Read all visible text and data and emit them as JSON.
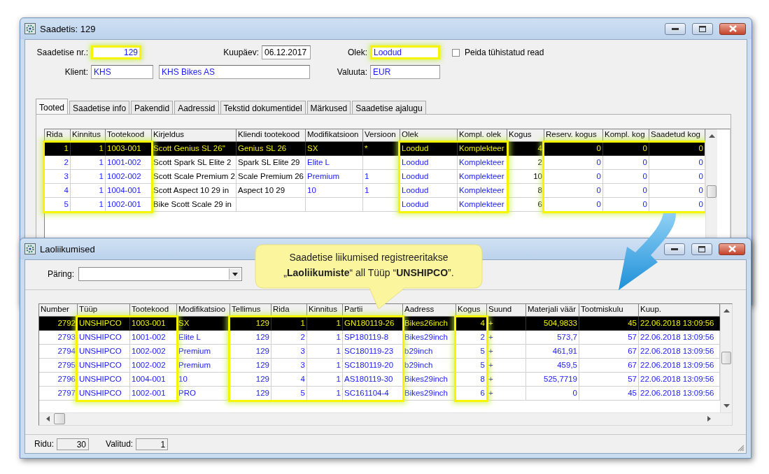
{
  "main_window": {
    "title": "Saadetis: 129",
    "shipment_no": {
      "label": "Saadetise nr.:",
      "value": "129",
      "kind": "ref",
      "highlighted": true
    },
    "date": {
      "label": "Kuupäev:",
      "value": "06.12.2017",
      "kind": "text",
      "highlighted": false
    },
    "status": {
      "label": "Olek:",
      "value": "Loodud",
      "kind": "ref",
      "highlighted": true
    },
    "hide_cancelled": {
      "label": "Peida tühistatud read",
      "checked": false
    },
    "client": {
      "label": "Klient:",
      "code": {
        "value": "KHS",
        "kind": "ref",
        "highlighted": false
      },
      "name": {
        "value": "KHS Bikes AS",
        "kind": "ref",
        "highlighted": false
      }
    },
    "currency": {
      "label": "Valuuta:",
      "value": "EUR",
      "kind": "ref",
      "highlighted": false
    },
    "tabs": [
      {
        "label": "Tooted",
        "selected": true
      },
      {
        "label": "Saadetise info",
        "selected": false
      },
      {
        "label": "Pakendid",
        "selected": false
      },
      {
        "label": "Aadressid",
        "selected": false
      },
      {
        "label": "Tekstid dokumentidel",
        "selected": false
      },
      {
        "label": "Märkused",
        "selected": false
      },
      {
        "label": "Saadetise ajalugu",
        "selected": false
      }
    ],
    "table": {
      "columns": [
        {
          "title": "Rida",
          "kind": "ref-number",
          "highlighted": true
        },
        {
          "title": "Kinnitus",
          "kind": "ref-number",
          "highlighted": true
        },
        {
          "title": "Tootekood",
          "kind": "ref-text",
          "highlighted": true
        },
        {
          "title": "Kirjeldus",
          "kind": "text",
          "highlighted": false
        },
        {
          "title": "Kliendi tootekood",
          "kind": "text",
          "highlighted": false
        },
        {
          "title": "Modifikatsioon",
          "kind": "ref-text",
          "highlighted": false
        },
        {
          "title": "Versioon",
          "kind": "ref-text",
          "highlighted": false
        },
        {
          "title": "Olek",
          "kind": "ref-text",
          "highlighted": true
        },
        {
          "title": "Kompl. olek",
          "kind": "ref-text",
          "highlighted": true
        },
        {
          "title": "Kogus",
          "kind": "number",
          "highlighted": false
        },
        {
          "title": "Reserv. kogus",
          "kind": "ref-number",
          "highlighted": true
        },
        {
          "title": "Kompl. kog",
          "kind": "ref-number",
          "highlighted": true
        },
        {
          "title": "Saadetud kog",
          "kind": "ref-number",
          "highlighted": true
        }
      ],
      "rows": [
        {
          "selected": true,
          "cells": [
            "1",
            "1",
            "1003-001",
            "Scott Genius SL 26''",
            "Genius SL 26",
            "SX",
            "*",
            "Loodud",
            "Komplekteer",
            "4",
            "0",
            "0",
            "0"
          ]
        },
        {
          "selected": false,
          "cells": [
            "2",
            "1",
            "1001-002",
            "Scott Spark SL Elite 2",
            "Spark SL Elite 29",
            "Elite L",
            null,
            "Loodud",
            "Komplekteer",
            "2",
            "0",
            "0",
            "0"
          ]
        },
        {
          "selected": false,
          "cells": [
            "3",
            "1",
            "1002-002",
            "Scott Scale Premium 2",
            "Scale Premium 26",
            "Premium",
            "1",
            "Loodud",
            "Komplekteer",
            "10",
            "0",
            "0",
            "0"
          ]
        },
        {
          "selected": false,
          "cells": [
            "4",
            "1",
            "1004-001",
            "Scott Aspect 10 29 in",
            "Aspect 10 29",
            "10",
            "1",
            "Loodud",
            "Komplekteer",
            "8",
            "0",
            "0",
            "0"
          ]
        },
        {
          "selected": false,
          "cells": [
            "5",
            "1",
            "1002-001",
            "Bike Scott Scale 29 in",
            null,
            null,
            null,
            "Loodud",
            "Komplekteer",
            "6",
            "0",
            "0",
            "0"
          ]
        }
      ]
    }
  },
  "movements_window": {
    "title": "Laoliikumised",
    "query": {
      "label": "Päring:"
    },
    "table": {
      "columns": [
        {
          "title": "Number",
          "kind": "ref-number",
          "highlighted": false
        },
        {
          "title": "Tüüp",
          "kind": "ref-text",
          "highlighted": true
        },
        {
          "title": "Tootekood",
          "kind": "ref-text",
          "highlighted": true
        },
        {
          "title": "Modifikatsioo",
          "kind": "ref-text",
          "highlighted": false
        },
        {
          "title": "Tellimus",
          "kind": "ref-number",
          "highlighted": true
        },
        {
          "title": "Rida",
          "kind": "ref-number",
          "highlighted": true
        },
        {
          "title": "Kinnitus",
          "kind": "ref-number",
          "highlighted": true
        },
        {
          "title": "Partii",
          "kind": "ref-text",
          "highlighted": true
        },
        {
          "title": "Aadress",
          "kind": "ref-text",
          "highlighted": false
        },
        {
          "title": "Kogus",
          "kind": "ref-number",
          "highlighted": true
        },
        {
          "title": "Suund",
          "kind": "ref-text",
          "highlighted": false
        },
        {
          "title": "Materjali väär",
          "kind": "ref-number",
          "highlighted": false
        },
        {
          "title": "Tootmiskulu",
          "kind": "ref-number",
          "highlighted": false
        },
        {
          "title": "Kuup.",
          "kind": "ref-text",
          "highlighted": false
        }
      ],
      "rows": [
        {
          "selected": true,
          "cells": [
            "2792",
            "UNSHIPCO",
            "1003-001",
            "SX",
            "129",
            "1",
            "1",
            "GN180119-26",
            "Bikes26inch",
            "4",
            "+",
            "504,9833",
            "45",
            "22.06.2018 13:09:56"
          ]
        },
        {
          "selected": false,
          "cells": [
            "2793",
            "UNSHIPCO",
            "1001-002",
            "Elite L",
            "129",
            "2",
            "1",
            "SP180119-8",
            "Bikes29inch",
            "2",
            "+",
            "573,7",
            "57",
            "22.06.2018 13:09:56"
          ]
        },
        {
          "selected": false,
          "cells": [
            "2794",
            "UNSHIPCO",
            "1002-002",
            "Premium",
            "129",
            "3",
            "1",
            "SC180119-23",
            "b29inch",
            "5",
            "+",
            "461,91",
            "67",
            "22.06.2018 13:09:56"
          ]
        },
        {
          "selected": false,
          "cells": [
            "2795",
            "UNSHIPCO",
            "1002-002",
            "Premium",
            "129",
            "3",
            "1",
            "SC180119-20",
            "b29inch",
            "5",
            "+",
            "459,5",
            "67",
            "22.06.2018 13:09:56"
          ]
        },
        {
          "selected": false,
          "cells": [
            "2796",
            "UNSHIPCO",
            "1004-001",
            "10",
            "129",
            "4",
            "1",
            "AS180119-30",
            "Bikes29inch",
            "8",
            "+",
            "525,7719",
            "57",
            "22.06.2018 13:09:56"
          ]
        },
        {
          "selected": false,
          "cells": [
            "2797",
            "UNSHIPCO",
            "1002-001",
            "PRO",
            "129",
            "5",
            "1",
            "SC161104-4",
            "Bikes29inch",
            "6",
            "+",
            "0",
            "45",
            "22.06.2018 13:09:56"
          ]
        }
      ]
    },
    "status_bar": {
      "rows_label": "Ridu:",
      "rows_value": "30",
      "selected_label": "Valitud:",
      "selected_value": "1"
    }
  },
  "callout": {
    "text": "Saadetise liikumised registreeritakse „**Laoliikumiste**“ all Tüüp “**UNSHIPCO**”."
  }
}
